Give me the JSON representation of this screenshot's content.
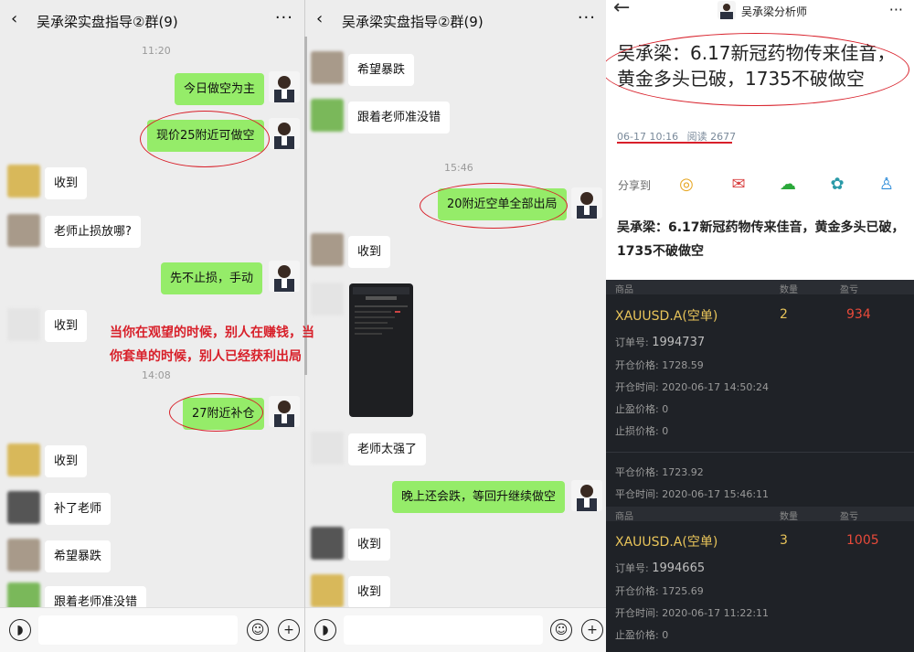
{
  "chat1": {
    "header": {
      "title": "吴承梁实盘指导②群(9)",
      "back": "‹",
      "more": "···"
    },
    "times": [
      "11:20",
      "14:08"
    ],
    "messages": [
      {
        "text": "今日做空为主",
        "from": "me"
      },
      {
        "text": "现价25附近可做空",
        "from": "me"
      },
      {
        "text": "收到",
        "from": "other"
      },
      {
        "text": "老师止损放哪?",
        "from": "other"
      },
      {
        "text": "先不止损，手动",
        "from": "me"
      },
      {
        "text": "收到",
        "from": "other"
      },
      {
        "text": "27附近补仓",
        "from": "me"
      },
      {
        "text": "收到",
        "from": "other"
      },
      {
        "text": "补了老师",
        "from": "other"
      },
      {
        "text": "希望暴跌",
        "from": "other"
      },
      {
        "text": "跟着老师准没错",
        "from": "other"
      }
    ]
  },
  "chat2": {
    "header": {
      "title": "吴承梁实盘指导②群(9)",
      "back": "‹",
      "more": "···"
    },
    "times": [
      "15:46"
    ],
    "messages": [
      {
        "text": "希望暴跌",
        "from": "other"
      },
      {
        "text": "跟着老师准没错",
        "from": "other"
      },
      {
        "text": "20附近空单全部出局",
        "from": "me"
      },
      {
        "text": "收到",
        "from": "other"
      },
      {
        "text": "老师太强了",
        "from": "other"
      },
      {
        "text": "晚上还会跌，等回升继续做空",
        "from": "me"
      },
      {
        "text": "收到",
        "from": "other"
      },
      {
        "text": "收到",
        "from": "other"
      }
    ]
  },
  "overlay_note": {
    "line1": "当你在观望的时候，别人在赚钱，当",
    "line2": "你套单的时候，别人已经获利出局"
  },
  "input_bar": {
    "voice_icon": "voice-icon",
    "emoji_icon": "emoji-icon",
    "plus_icon": "plus-icon"
  },
  "article": {
    "header": {
      "author": "吴承梁分析师",
      "back": "←",
      "more": "···"
    },
    "title": "吴承梁：6.17新冠药物传来佳音，黄金多头已破，1735不破做空",
    "date": "06-17 10:16",
    "read": "阅读 2677",
    "share_label": "分享到",
    "share_icons": [
      "weibo-icon",
      "mail-icon",
      "wechat-icon",
      "moments-icon",
      "qq-icon"
    ],
    "summary": "吴承梁：6.17新冠药物传来佳音，黄金多头已破，1735不破做空",
    "columns": [
      "商品",
      "数量",
      "盈亏"
    ],
    "orders": [
      {
        "symbol": "XAUUSD.A",
        "side": "(空单)",
        "qty": "2",
        "pnl": "934",
        "order_no_label": "订单号:",
        "order_no": "1994737",
        "open_price_label": "开仓价格:",
        "open_price": "1728.59",
        "open_time_label": "开仓时间:",
        "open_time": "2020-06-17 14:50:24",
        "stop_loss_label": "止盈价格:",
        "stop_loss": "0",
        "take_profit_label": "止损价格:",
        "take_profit": "0",
        "close_price_label": "平仓价格:",
        "close_price": "1723.92",
        "close_time_label": "平仓时间:",
        "close_time": "2020-06-17 15:46:11"
      },
      {
        "symbol": "XAUUSD.A",
        "side": "(空单)",
        "qty": "3",
        "pnl": "1005",
        "order_no_label": "订单号:",
        "order_no": "1994665",
        "open_price_label": "开仓价格:",
        "open_price": "1725.69",
        "open_time_label": "开仓时间:",
        "open_time": "2020-06-17 11:22:11",
        "stop_loss_label": "止盈价格:",
        "stop_loss": "0"
      }
    ]
  },
  "colors": {
    "my_bubble": "#95ec69",
    "annotation": "#d8202a",
    "gold": "#e8c45a",
    "profit": "#e84a3a"
  }
}
